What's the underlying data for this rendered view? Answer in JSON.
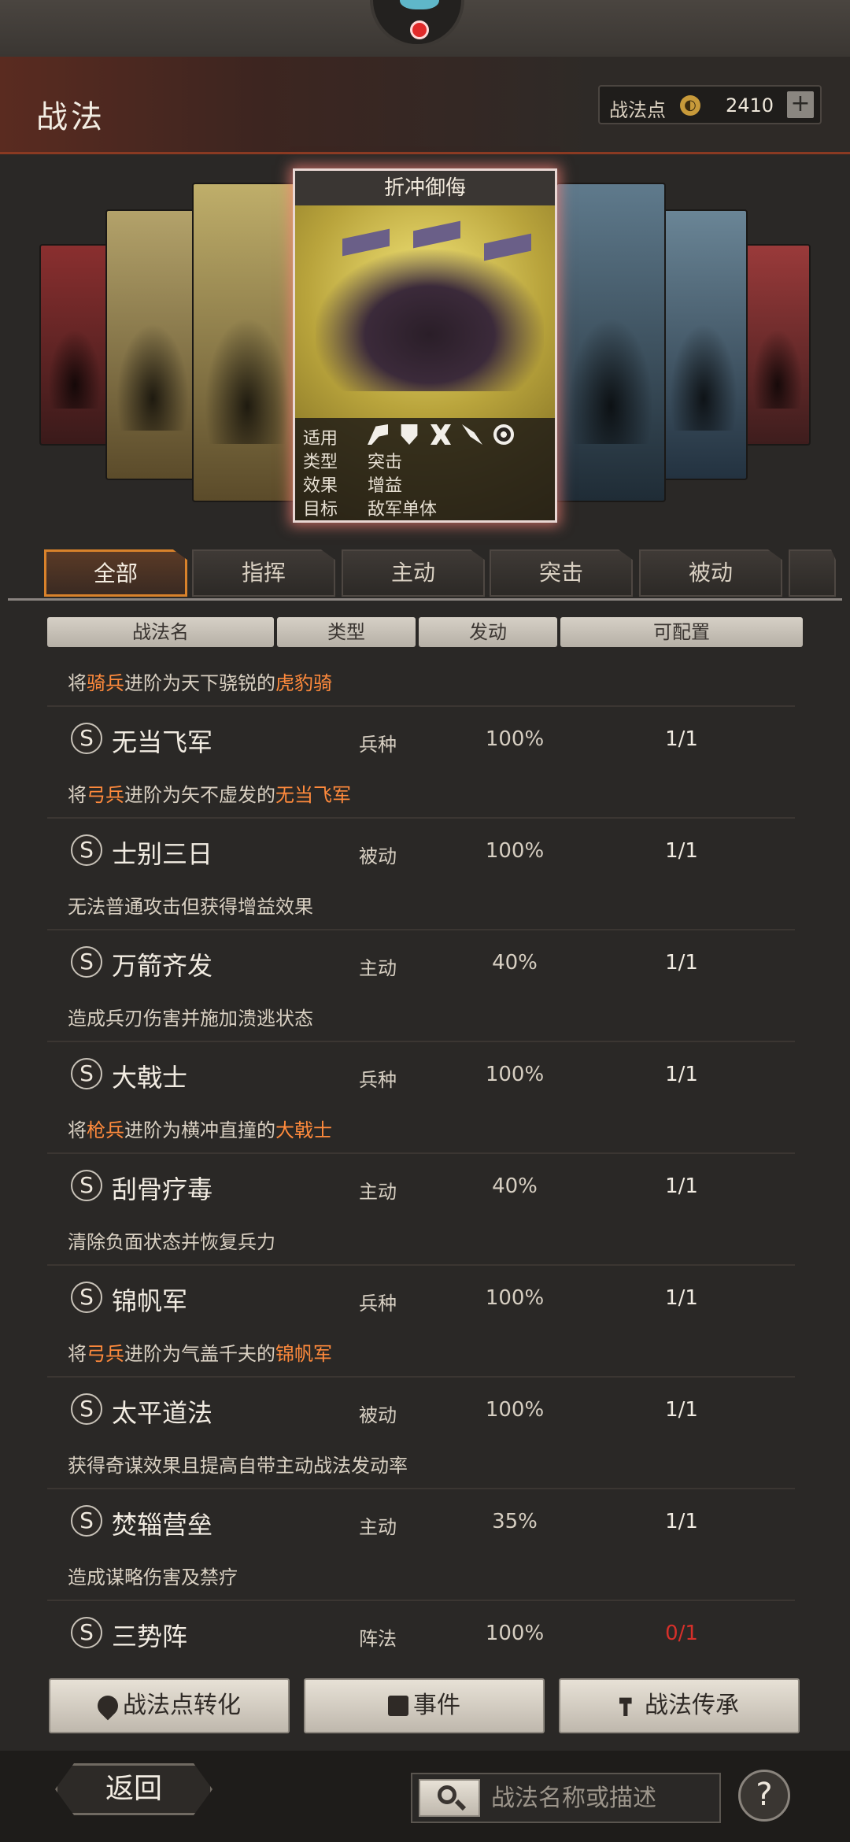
{
  "header": {
    "title": "战法",
    "points_label": "战法点",
    "points_value": "2410",
    "add_symbol": "+"
  },
  "featured_card": {
    "title": "折冲御侮",
    "applicable_label": "适用",
    "applicable_icons": [
      "axe-icon",
      "shield-icon",
      "bow-icon",
      "spear-icon",
      "wheel-icon"
    ],
    "type_label": "类型",
    "type_value": "突击",
    "effect_label": "效果",
    "effect_value": "增益",
    "target_label": "目标",
    "target_value": "敌军单体"
  },
  "tabs": [
    "全部",
    "指挥",
    "主动",
    "突击",
    "被动"
  ],
  "active_tab": 0,
  "columns": [
    "战法名",
    "类型",
    "发动",
    "可配置"
  ],
  "top_desc": {
    "pre": "将",
    "hl1": "骑兵",
    "mid": "进阶为天下骁锐的",
    "hl2": "虎豹骑"
  },
  "items": [
    {
      "grade": "S",
      "name": "无当飞军",
      "type": "兵种",
      "rate": "100%",
      "config": "1/1",
      "desc": {
        "pre": "将",
        "hl1": "弓兵",
        "mid": "进阶为矢不虚发的",
        "hl2": "无当飞军"
      }
    },
    {
      "grade": "S",
      "name": "士别三日",
      "type": "被动",
      "rate": "100%",
      "config": "1/1",
      "desc": {
        "pre": "无法普通攻击但获得增益效果"
      }
    },
    {
      "grade": "S",
      "name": "万箭齐发",
      "type": "主动",
      "rate": "40%",
      "config": "1/1",
      "desc": {
        "pre": "造成兵刃伤害并施加溃逃状态"
      }
    },
    {
      "grade": "S",
      "name": "大戟士",
      "type": "兵种",
      "rate": "100%",
      "config": "1/1",
      "desc": {
        "pre": "将",
        "hl1": "枪兵",
        "mid": "进阶为横冲直撞的",
        "hl2": "大戟士"
      }
    },
    {
      "grade": "S",
      "name": "刮骨疗毒",
      "type": "主动",
      "rate": "40%",
      "config": "1/1",
      "desc": {
        "pre": "清除负面状态并恢复兵力"
      }
    },
    {
      "grade": "S",
      "name": "锦帆军",
      "type": "兵种",
      "rate": "100%",
      "config": "1/1",
      "desc": {
        "pre": "将",
        "hl1": "弓兵",
        "mid": "进阶为气盖千夫的",
        "hl2": "锦帆军"
      }
    },
    {
      "grade": "S",
      "name": "太平道法",
      "type": "被动",
      "rate": "100%",
      "config": "1/1",
      "desc": {
        "pre": "获得奇谋效果且提高自带主动战法发动率"
      }
    },
    {
      "grade": "S",
      "name": "焚辎营垒",
      "type": "主动",
      "rate": "35%",
      "config": "1/1",
      "desc": {
        "pre": "造成谋略伤害及禁疗"
      }
    },
    {
      "grade": "S",
      "name": "三势阵",
      "type": "阵法",
      "rate": "100%",
      "config": "0/1",
      "config_red": true,
      "desc": {
        "pre": ""
      }
    }
  ],
  "actions": {
    "convert": "战法点转化",
    "events": "事件",
    "inherit": "战法传承"
  },
  "footer": {
    "back": "返回",
    "search_placeholder": "战法名称或描述",
    "help": "?"
  },
  "colors": {
    "accent_orange": "#d9822b",
    "highlight_text": "#ff8a3c",
    "warning_red": "#d6302a"
  }
}
